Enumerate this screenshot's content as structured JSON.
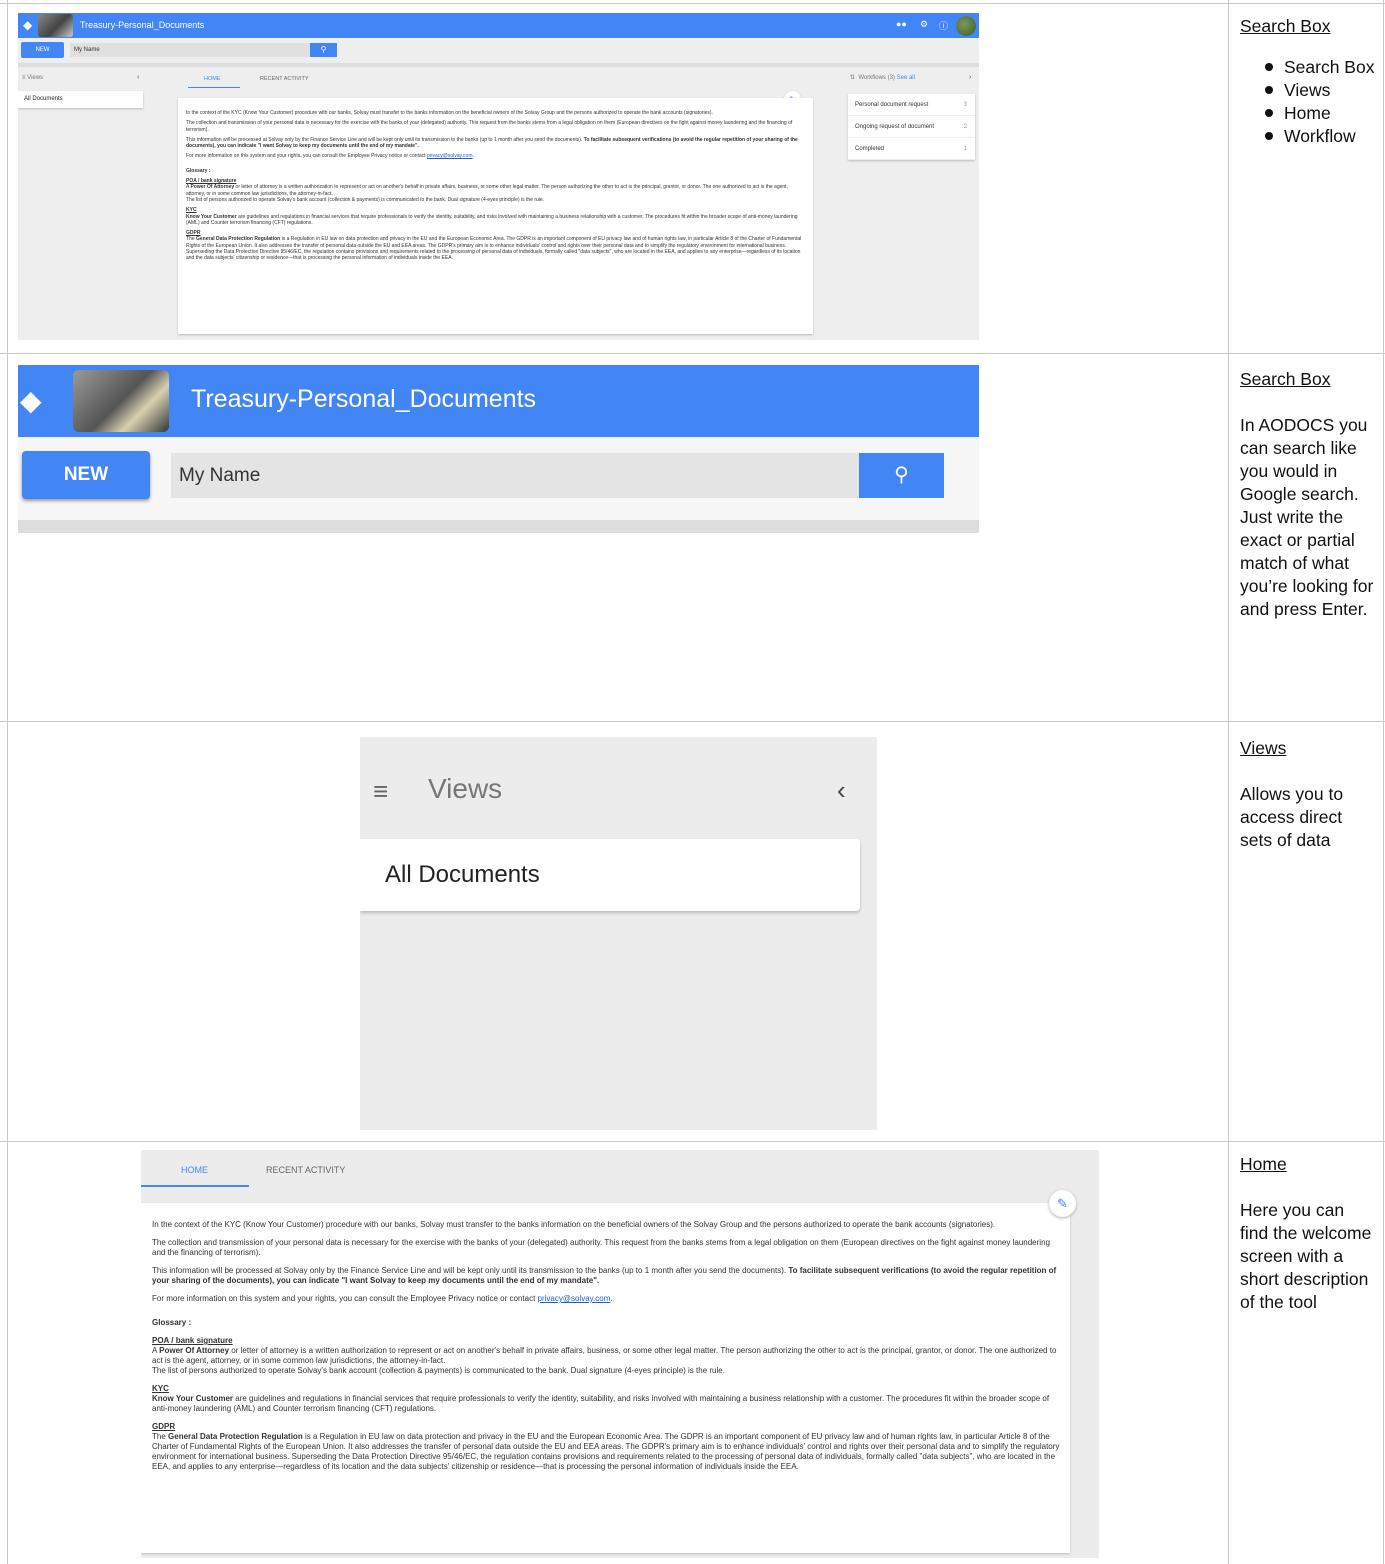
{
  "app": {
    "title": "Treasury-Personal_Documents",
    "new_label": "NEW",
    "search_value": "My Name"
  },
  "views": {
    "heading": "Views",
    "items": [
      "All Documents"
    ]
  },
  "tabs": {
    "home": "HOME",
    "recent": "RECENT ACTIVITY"
  },
  "workflows": {
    "heading": "Workflows (3)",
    "see_all": "See all",
    "items": [
      {
        "label": "Personal document request",
        "count": "3"
      },
      {
        "label": "Ongoing request of document",
        "count": "2"
      },
      {
        "label": "Completed",
        "count": "1"
      }
    ]
  },
  "home": {
    "p1": "In the context of the KYC (Know Your Customer) procedure with our banks, Solvay must transfer to the banks information on the beneficial owners of the Solvay Group and the persons authorized to operate the bank accounts (signatories).",
    "p2": "The collection and transmission of your personal data is necessary for the exercise with the banks of your (delegated) authority. This request from the banks stems from a legal obligation on them (European directives on the fight against money laundering and the financing of terrorism).",
    "p3a": "This information will be processed at Solvay only by the Finance Service Line and will be kept only until its transmission to the banks (up to 1 month after you send the documents). ",
    "p3b": "To facilitate subsequent verifications (to avoid the regular repetition of your sharing of the documents), you can indicate \"I want Solvay to keep my documents until the end of my mandate\".",
    "p4a": "For more information on this system and your rights, you can consult the Employee Privacy notice or contact ",
    "p4_link": "privacy@solvay.com",
    "p4b": ".",
    "glossary": "Glossary :",
    "poa_title": "POA / bank signature",
    "poa_a": "A ",
    "poa_bold": "Power Of Attorney",
    "poa_b": " or letter of attorney is a written authorization to represent or act on another's behalf in private affairs, business, or some other legal matter. The person authorizing the other to act is the principal, grantor, or donor. The one authorized to act is the agent, attorney, or in some common law jurisdictions, the attorney-in-fact.",
    "poa_c": "The list of persons authorized to operate Solvay's bank account (collection & payments) is communicated to the bank. Dual signature (4-eyes principle) is the rule.",
    "kyc_title": "KYC",
    "kyc_bold": "Know Your Customer",
    "kyc_b": " are guidelines and regulations in financial services that require professionals to verify the identity, suitability, and risks involved with maintaining a business relationship with a customer. The procedures fit within the broader scope of anti-money laundering (AML) and Counter terrorism financing (CFT) regulations.",
    "gdpr_title": "GDPR",
    "gdpr_a": "The ",
    "gdpr_bold": "General Data Protection Regulation",
    "gdpr_b": " is a Regulation in EU law on data protection and privacy in the EU and the European Economic Area. The GDPR is an important component of EU privacy law and of human rights law, in particular Article 8 of the Charter of Fundamental Rights of the European Union. It also addresses the transfer of personal data outside the EU and EEA areas. The GDPR's primary aim is to enhance individuals' control and rights over their personal data and to simplify the regulatory environment for international business. Superseding the Data Protection Directive 95/46/EC, the regulation contains provisions and requirements related to the processing of personal data of individuals, formally called \"data subjects\", who are located in the EEA, and applies to any enterprise—regardless of its location and the data subjects' citizenship or residence—that is processing the personal information of individuals inside the EEA."
  },
  "annotations": {
    "row1_title": "Search Box",
    "row1_list": [
      "Search Box",
      "Views",
      "Home",
      "Workflow"
    ],
    "row2_title": "Search Box",
    "row2_text": "In AODOCS you can search like you would in Google search. Just write the exact or partial match of what you’re looking for and press Enter.",
    "row3_title": "Views",
    "row3_text": "Allows you to access direct sets of data",
    "row4_title": "Home",
    "row4_text": "Here you can find the welcome screen with a short description of the tool"
  },
  "colors": {
    "accent": "#4285f4",
    "panel_bg": "#eeeeee"
  },
  "icons": [
    "layers-icon",
    "people-icon",
    "gear-icon",
    "help-icon",
    "avatar",
    "search-icon",
    "views-icon",
    "chevron-left-icon",
    "chevron-right-icon",
    "workflow-icon",
    "pencil-icon"
  ]
}
